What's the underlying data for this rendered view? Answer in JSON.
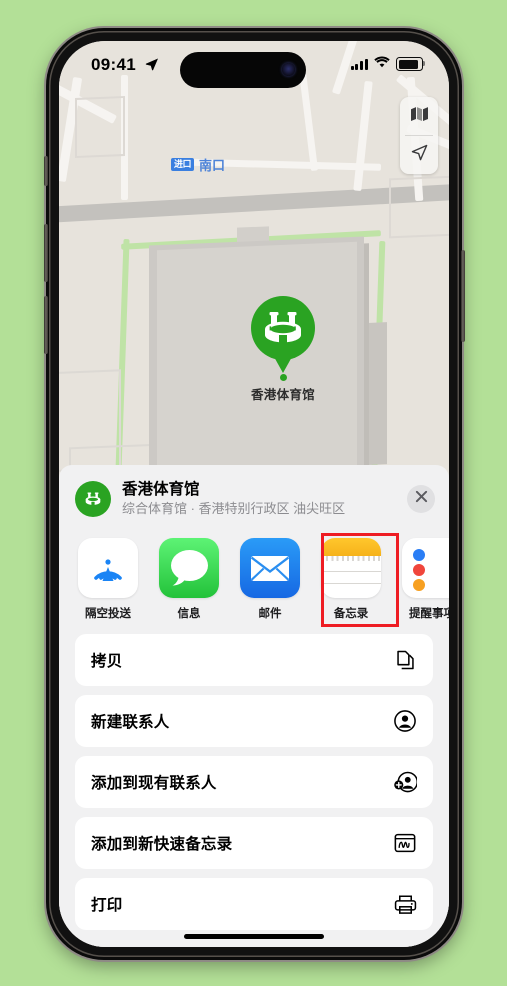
{
  "status_bar": {
    "time": "09:41",
    "location_arrow_icon": "location-arrow-icon",
    "cellular_icon": "cellular-bars-icon",
    "wifi_icon": "wifi-icon",
    "battery_icon": "battery-icon"
  },
  "map": {
    "entrance_badge": "进口",
    "entrance_label": "南口",
    "poi_label": "香港体育馆",
    "poi_pin_icon": "stadium-pin-icon",
    "controls": {
      "map_mode_icon": "map-layers-icon",
      "locate_icon": "location-arrow-icon"
    }
  },
  "share_sheet": {
    "title": "香港体育馆",
    "subtitle": "综合体育馆 · 香港特别行政区 油尖旺区",
    "poi_icon": "stadium-icon",
    "close_icon": "close-icon",
    "apps": [
      {
        "label": "隔空投送",
        "icon": "airdrop-icon"
      },
      {
        "label": "信息",
        "icon": "messages-icon"
      },
      {
        "label": "邮件",
        "icon": "mail-icon"
      },
      {
        "label": "备忘录",
        "icon": "notes-icon",
        "highlighted": true
      },
      {
        "label": "提醒事项",
        "icon": "reminders-icon"
      }
    ],
    "actions": [
      {
        "label": "拷贝",
        "icon": "copy-icon"
      },
      {
        "label": "新建联系人",
        "icon": "new-contact-icon"
      },
      {
        "label": "添加到现有联系人",
        "icon": "add-to-contact-icon"
      },
      {
        "label": "添加到新快速备忘录",
        "icon": "quick-note-icon"
      },
      {
        "label": "打印",
        "icon": "printer-icon"
      }
    ]
  },
  "colors": {
    "background": "#b3e097",
    "accent_green": "#2aa322",
    "highlight_red": "#ee1c23",
    "map_blue": "#3a7fe0"
  }
}
